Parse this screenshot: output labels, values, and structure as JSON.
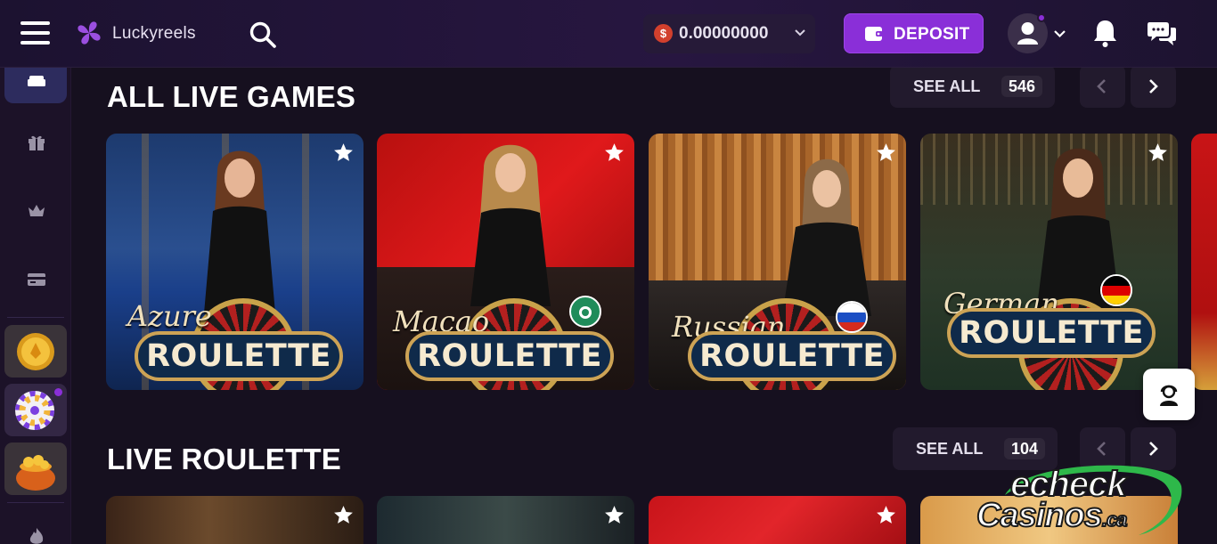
{
  "header": {
    "brand": "Luckyreels",
    "balance": "0.00000000",
    "currency_symbol": "$",
    "deposit_label": "DEPOSIT"
  },
  "sections": [
    {
      "title": "ALL LIVE GAMES",
      "see_all_label": "SEE ALL",
      "count": "546",
      "games": [
        {
          "script": "Azure",
          "name": "ROULETTE",
          "flag": ""
        },
        {
          "script": "Macao",
          "name": "ROULETTE",
          "flag": "macau-flag-icon"
        },
        {
          "script": "Russian",
          "name": "ROULETTE",
          "flag": "russia-flag-icon"
        },
        {
          "script": "German",
          "name": "ROULETTE",
          "flag": "germany-flag-icon"
        }
      ]
    },
    {
      "title": "LIVE ROULETTE",
      "see_all_label": "SEE ALL",
      "count": "104"
    }
  ],
  "watermark": {
    "line1": "echeck",
    "line2": "Casinos",
    "suffix": ".ca"
  },
  "colors": {
    "accent": "#8a2fd8",
    "background": "#16101f",
    "header": "#241533",
    "sidebar_active": "#2d2c5e",
    "button": "#221a2d"
  },
  "icons": {
    "menu": "hamburger-menu-icon",
    "search": "search-icon",
    "wallet": "wallet-icon",
    "notifications": "bell-icon",
    "chat": "chat-icon",
    "favorite": "star-icon",
    "support": "support-agent-icon"
  }
}
